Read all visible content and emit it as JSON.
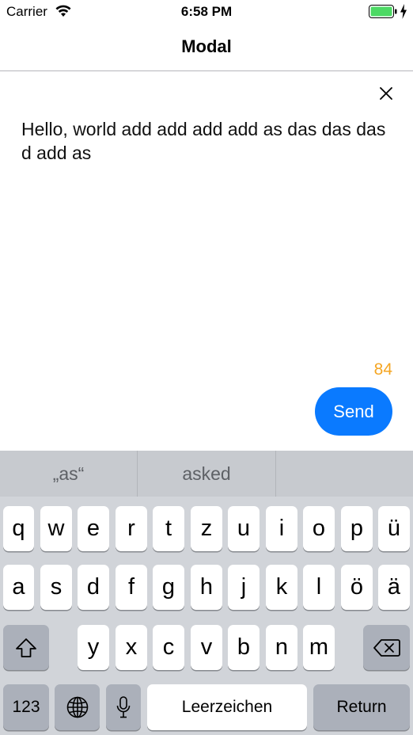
{
  "status_bar": {
    "carrier": "Carrier",
    "time": "6:58 PM",
    "battery_color": "#4cd964"
  },
  "nav": {
    "title": "Modal"
  },
  "compose": {
    "text": "Hello, world add add add add as das das das d add as",
    "remaining_chars": "84",
    "send_label": "Send",
    "accent_color": "#0a7aff",
    "counter_color": "#f5a623"
  },
  "keyboard": {
    "suggestions": [
      "„as“",
      "asked",
      ""
    ],
    "row1": [
      "q",
      "w",
      "e",
      "r",
      "t",
      "z",
      "u",
      "i",
      "o",
      "p",
      "ü"
    ],
    "row2": [
      "a",
      "s",
      "d",
      "f",
      "g",
      "h",
      "j",
      "k",
      "l",
      "ö",
      "ä"
    ],
    "row3": [
      "y",
      "x",
      "c",
      "v",
      "b",
      "n",
      "m"
    ],
    "numbers_label": "123",
    "space_label": "Leerzeichen",
    "return_label": "Return",
    "icons": [
      "shift-icon",
      "backspace-icon",
      "globe-icon",
      "microphone-icon"
    ]
  }
}
